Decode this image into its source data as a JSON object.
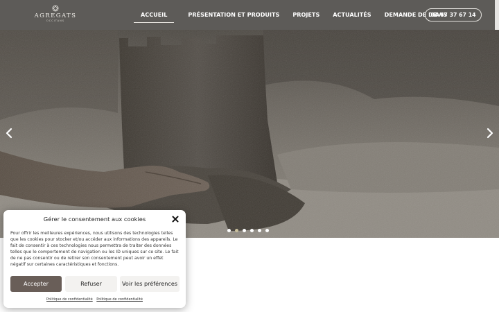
{
  "header": {
    "logo": {
      "name": "AGREGATS",
      "sub": "OCCITANS"
    },
    "nav": [
      {
        "label": "ACCUEIL",
        "active": true
      },
      {
        "label": "PRÉSENTATION ET PRODUITS",
        "active": false
      },
      {
        "label": "PROJETS",
        "active": false
      },
      {
        "label": "ACTUALITÉS",
        "active": false
      },
      {
        "label": "DEMANDE DE DEVIS",
        "active": false
      }
    ],
    "phone": "04 67 37 67 14"
  },
  "hero": {
    "image": "sand-castle-with-hand",
    "slides": 6,
    "active_slide": 2,
    "prev_icon": "chevron-left-icon",
    "next_icon": "chevron-right-icon"
  },
  "cookie": {
    "title": "Gérer le consentement aux cookies",
    "text": "Pour offrir les meilleures expériences, nous utilisons des technologies telles que les cookies pour stocker et/ou accéder aux informations des appareils. Le fait de consentir à ces technologies nous permettra de traiter des données telles que le comportement de navigation ou les ID uniques sur ce site. Le fait de ne pas consentir ou de retirer son consentement peut avoir un effet négatif sur certaines caractéristiques et fonctions.",
    "accept": "Accepter",
    "refuse": "Refuser",
    "preferences": "Voir les préférences",
    "links": [
      "Politique de confidentialité",
      "Politique de confidentialité"
    ],
    "close_icon": "close-icon"
  },
  "colors": {
    "header_bg": "#5d5b58",
    "accept_bg": "#695e58",
    "active_dot": "#c9bf9c"
  }
}
